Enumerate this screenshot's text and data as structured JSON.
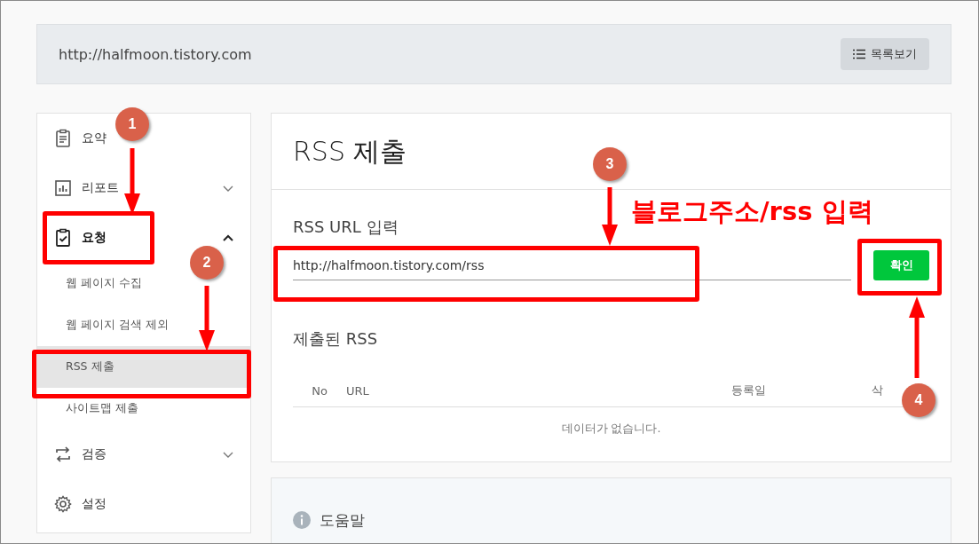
{
  "address_bar": {
    "url": "http://halfmoon.tistory.com",
    "list_button": "목록보기"
  },
  "sidebar": {
    "items": [
      {
        "kind": "link",
        "label": "요약",
        "selected": false
      },
      {
        "kind": "group",
        "label": "리포트",
        "selected": false,
        "expanded": false
      },
      {
        "kind": "group",
        "label": "요청",
        "selected": true,
        "expanded": true,
        "children": [
          {
            "label": "웹 페이지 수집",
            "selected": false
          },
          {
            "label": "웹 페이지 검색 제외",
            "selected": false
          },
          {
            "label": "RSS 제출",
            "selected": true
          },
          {
            "label": "사이트맵 제출",
            "selected": false
          }
        ]
      },
      {
        "kind": "group",
        "label": "검증",
        "selected": false,
        "expanded": false
      },
      {
        "kind": "link",
        "label": "설정",
        "selected": false
      }
    ]
  },
  "main": {
    "title": "RSS 제출",
    "url_label": "RSS URL 입력",
    "url_field": {
      "value": "http://halfmoon.tistory.com/rss"
    },
    "confirm_button": "확인",
    "submitted_title": "제출된 RSS",
    "table": {
      "columns": [
        "No",
        "URL",
        "등록일",
        "삭"
      ],
      "empty_message": "데이터가 없습니다."
    }
  },
  "help": {
    "title": "도움말"
  },
  "annotations": {
    "badges": [
      "1",
      "2",
      "3",
      "4"
    ],
    "caption": "블로그주소/rss 입력"
  }
}
